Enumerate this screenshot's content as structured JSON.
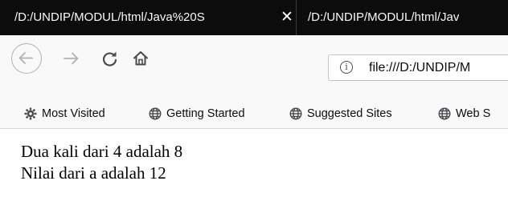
{
  "tabs": [
    {
      "title": "/D:/UNDIP/MODUL/html/Java%20S",
      "active": true,
      "close_icon": "close-icon"
    },
    {
      "title": "/D:/UNDIP/MODUL/html/Jav",
      "active": false
    }
  ],
  "toolbar": {
    "back_icon": "arrow-left-icon",
    "forward_icon": "arrow-right-icon",
    "reload_icon": "reload-icon",
    "home_icon": "home-icon"
  },
  "urlbar": {
    "info_icon": "info-icon",
    "info_glyph": "i",
    "url": "file:///D:/UNDIP/M"
  },
  "bookmarks": [
    {
      "label": "Most Visited",
      "icon": "gear-icon"
    },
    {
      "label": "Getting Started",
      "icon": "globe-icon"
    },
    {
      "label": "Suggested Sites",
      "icon": "globe-icon"
    },
    {
      "label": "Web S",
      "icon": "globe-icon"
    }
  ],
  "page": {
    "lines": [
      "Dua kali dari 4 adalah 8",
      "Nilai dari a adalah 12"
    ]
  },
  "colors": {
    "tab_bar": "#0c0c0d",
    "toolbar": "#f9f9fa",
    "icon": "#4a4a4f",
    "disabled_icon": "#b1b1b3"
  }
}
